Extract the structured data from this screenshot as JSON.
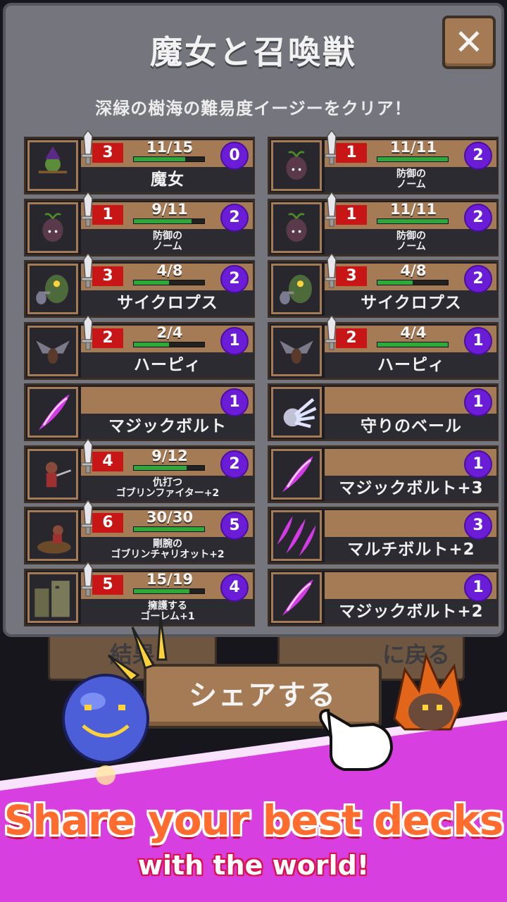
{
  "dialog": {
    "title": "魔女と召喚獣",
    "close_label": "✕",
    "subtitle": "深緑の樹海の難易度イージーをクリア！"
  },
  "cards": [
    {
      "name": "魔女",
      "small": false,
      "attack": "3",
      "hp": "11/15",
      "hp_fraction": 0.73,
      "cost": "0",
      "unit": true,
      "icon": "witch-icon"
    },
    {
      "name": "防御の\nノーム",
      "small": true,
      "attack": "1",
      "hp": "11/11",
      "hp_fraction": 1.0,
      "cost": "2",
      "unit": true,
      "icon": "gnome-icon"
    },
    {
      "name": "防御の\nノーム",
      "small": true,
      "attack": "1",
      "hp": "9/11",
      "hp_fraction": 0.82,
      "cost": "2",
      "unit": true,
      "icon": "gnome-icon"
    },
    {
      "name": "防御の\nノーム",
      "small": true,
      "attack": "1",
      "hp": "11/11",
      "hp_fraction": 1.0,
      "cost": "2",
      "unit": true,
      "icon": "gnome-icon"
    },
    {
      "name": "サイクロプス",
      "small": false,
      "attack": "3",
      "hp": "4/8",
      "hp_fraction": 0.5,
      "cost": "2",
      "unit": true,
      "icon": "cyclops-icon"
    },
    {
      "name": "サイクロプス",
      "small": false,
      "attack": "3",
      "hp": "4/8",
      "hp_fraction": 0.5,
      "cost": "2",
      "unit": true,
      "icon": "cyclops-icon"
    },
    {
      "name": "ハーピィ",
      "small": false,
      "attack": "2",
      "hp": "2/4",
      "hp_fraction": 0.5,
      "cost": "1",
      "unit": true,
      "icon": "harpy-icon"
    },
    {
      "name": "ハーピィ",
      "small": false,
      "attack": "2",
      "hp": "4/4",
      "hp_fraction": 1.0,
      "cost": "1",
      "unit": true,
      "icon": "harpy-icon"
    },
    {
      "name": "マジックボルト",
      "small": false,
      "cost": "1",
      "unit": false,
      "icon": "magic-bolt-icon"
    },
    {
      "name": "守りのベール",
      "small": false,
      "cost": "1",
      "unit": false,
      "icon": "veil-icon"
    },
    {
      "name": "仇打つ\nゴブリンファイター+2",
      "small": true,
      "attack": "4",
      "hp": "9/12",
      "hp_fraction": 0.75,
      "cost": "2",
      "unit": true,
      "icon": "goblin-fighter-icon"
    },
    {
      "name": "マジックボルト+3",
      "small": false,
      "cost": "1",
      "unit": false,
      "icon": "magic-bolt-icon"
    },
    {
      "name": "剛腕の\nゴブリンチャリオット+2",
      "small": true,
      "attack": "6",
      "hp": "30/30",
      "hp_fraction": 1.0,
      "cost": "5",
      "unit": true,
      "icon": "goblin-chariot-icon"
    },
    {
      "name": "マルチボルト+2",
      "small": false,
      "cost": "3",
      "unit": false,
      "icon": "multi-bolt-icon"
    },
    {
      "name": "擁護する\nゴーレム+1",
      "small": true,
      "attack": "5",
      "hp": "15/19",
      "hp_fraction": 0.79,
      "cost": "4",
      "unit": true,
      "icon": "golem-icon"
    },
    {
      "name": "マジックボルト+2",
      "small": false,
      "cost": "1",
      "unit": false,
      "icon": "magic-bolt-icon"
    }
  ],
  "background_buttons": {
    "results": "結果",
    "back": "に戻る"
  },
  "share_button": "シェアする",
  "promo": {
    "line1": "Share your best decks",
    "line2": "with the world!"
  },
  "colors": {
    "panel": "#75767d",
    "card_brown": "#a47b55",
    "attack_red": "#c81515",
    "cost_purple": "#6a1cd6",
    "hp_green": "#2fa83a",
    "banner_pink": "#d83fe0"
  }
}
